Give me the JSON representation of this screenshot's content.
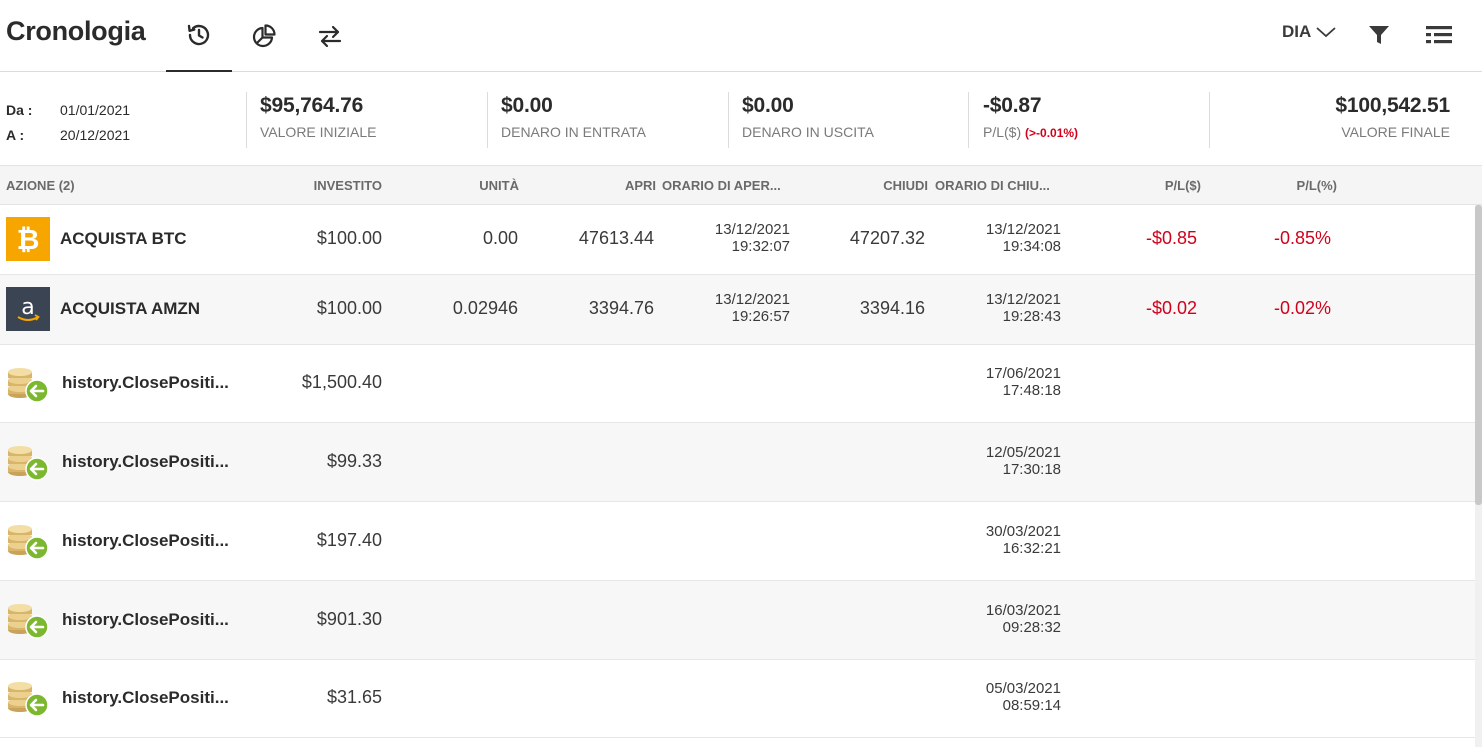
{
  "header": {
    "title": "Cronologia",
    "tabs": [
      {
        "name": "history-icon"
      },
      {
        "name": "pie-chart-icon"
      },
      {
        "name": "transfer-icon"
      }
    ],
    "period_label": "DIA"
  },
  "summary": {
    "from_label": "Da :",
    "from_value": "01/01/2021",
    "to_label": "A :",
    "to_value": "20/12/2021",
    "initial_value": "$95,764.76",
    "initial_label": "VALORE INIZIALE",
    "money_in": "$0.00",
    "money_in_label": "DENARO IN ENTRATA",
    "money_out": "$0.00",
    "money_out_label": "DENARO IN USCITA",
    "pl_value": "-$0.87",
    "pl_label": "P/L($)",
    "pl_percent": "(>-0.01%)",
    "final_value": "$100,542.51",
    "final_label": "VALORE FINALE"
  },
  "table": {
    "columns": {
      "action": "AZIONE (2)",
      "invested": "INVESTITO",
      "units": "UNITÀ",
      "open": "APRI",
      "open_time": "ORARIO DI APER...",
      "close": "CHIUDI",
      "close_time": "ORARIO DI CHIU...",
      "pl_usd": "P/L($)",
      "pl_pct": "P/L(%)"
    },
    "trades": [
      {
        "asset": "ACQUISTA BTC",
        "logo": "bitcoin-logo",
        "invested": "$100.00",
        "units": "0.00",
        "open": "47613.44",
        "open_date": "13/12/2021",
        "open_time": "19:32:07",
        "close": "47207.32",
        "close_date": "13/12/2021",
        "close_time": "19:34:08",
        "pl_usd": "-$0.85",
        "pl_pct": "-0.85%"
      },
      {
        "asset": "ACQUISTA AMZN",
        "logo": "amazon-logo",
        "invested": "$100.00",
        "units": "0.02946",
        "open": "3394.76",
        "open_date": "13/12/2021",
        "open_time": "19:26:57",
        "close": "3394.16",
        "close_date": "13/12/2021",
        "close_time": "19:28:43",
        "pl_usd": "-$0.02",
        "pl_pct": "-0.02%"
      }
    ],
    "transfers": [
      {
        "label": "history.ClosePositi...",
        "amount": "$1,500.40",
        "date": "17/06/2021",
        "time": "17:48:18"
      },
      {
        "label": "history.ClosePositi...",
        "amount": "$99.33",
        "date": "12/05/2021",
        "time": "17:30:18"
      },
      {
        "label": "history.ClosePositi...",
        "amount": "$197.40",
        "date": "30/03/2021",
        "time": "16:32:21"
      },
      {
        "label": "history.ClosePositi...",
        "amount": "$901.30",
        "date": "16/03/2021",
        "time": "09:28:32"
      },
      {
        "label": "history.ClosePositi...",
        "amount": "$31.65",
        "date": "05/03/2021",
        "time": "08:59:14"
      }
    ]
  },
  "colors": {
    "negative": "#d0021b",
    "bitcoin": "#f7a600",
    "amazon": "#3a4452",
    "coin_arrow": "#7cb82f"
  }
}
